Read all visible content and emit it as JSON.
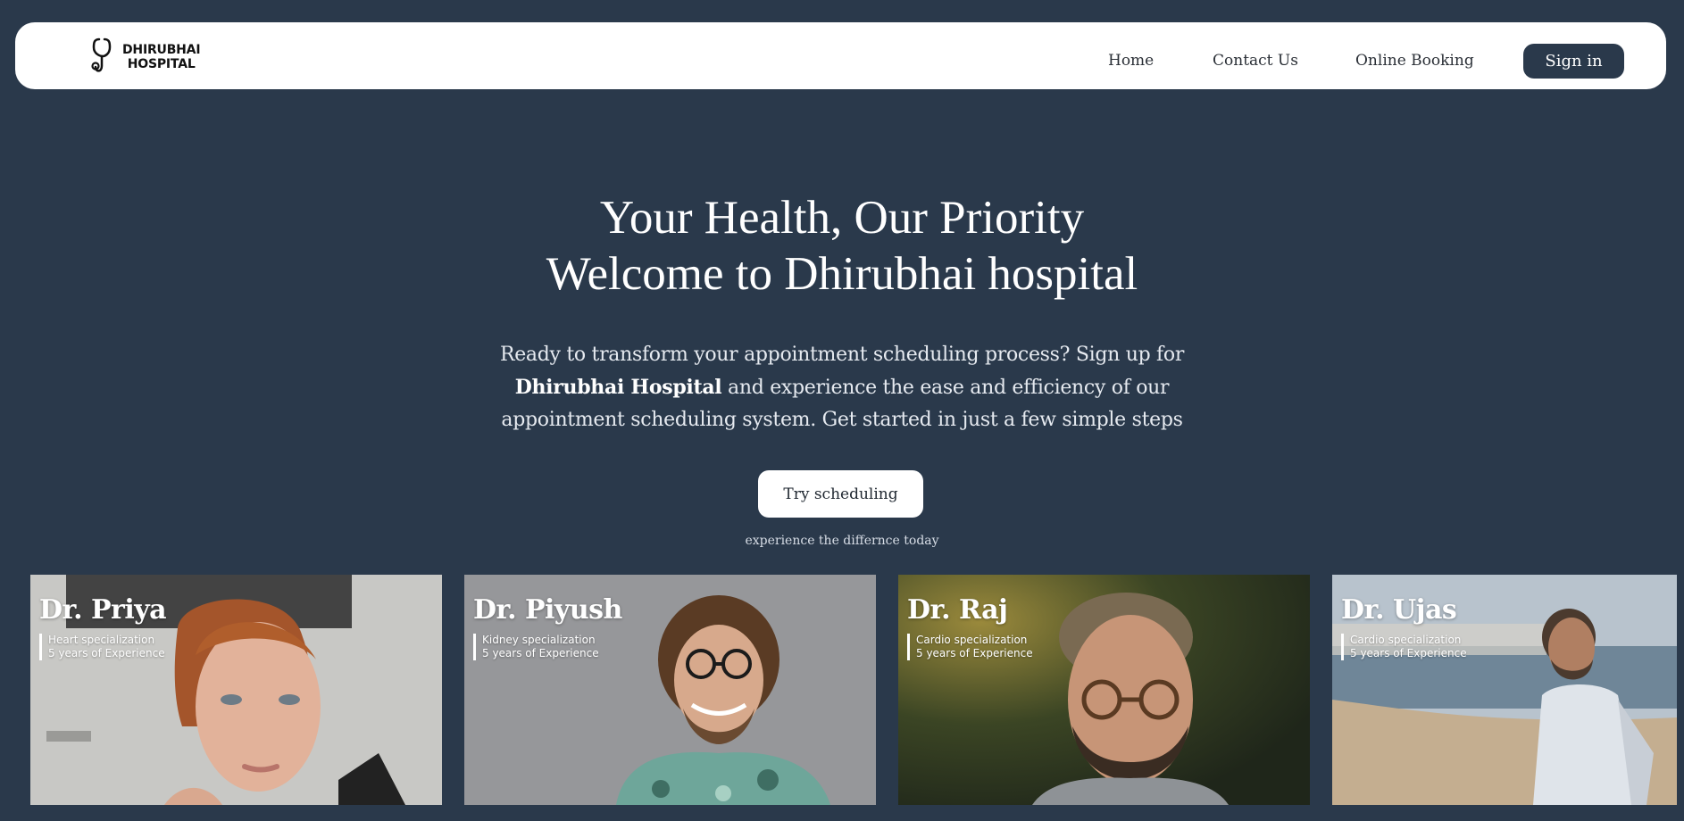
{
  "logo": {
    "line1": "DHIRUBHAI",
    "line2": "HOSPITAL",
    "icon": "stethoscope-icon"
  },
  "nav": {
    "home": "Home",
    "contact": "Contact Us",
    "booking": "Online Booking",
    "signin": "Sign in"
  },
  "hero": {
    "title_line1": "Your Health, Our Priority",
    "title_line2": "Welcome to Dhirubhai hospital",
    "desc_part1": "Ready to transform your appointment scheduling process? Sign up for ",
    "desc_bold": "Dhirubhai Hospital",
    "desc_part2": " and experience the ease and efficiency of our appointment scheduling system. Get started in just a few simple steps",
    "cta": "Try scheduling",
    "caption": "experience the differnce today"
  },
  "doctors": [
    {
      "name": "Dr. Priya",
      "specialization": "Heart specialization",
      "experience": "5 years of Experience"
    },
    {
      "name": "Dr. Piyush",
      "specialization": "Kidney specialization",
      "experience": "5 years of Experience"
    },
    {
      "name": "Dr. Raj",
      "specialization": "Cardio specialization",
      "experience": "5 years of Experience"
    },
    {
      "name": "Dr. Ujas",
      "specialization": "Cardio specialization",
      "experience": "5 years of Experience"
    }
  ],
  "colors": {
    "background": "#2a394b",
    "navbar": "#ffffff",
    "accent": "#2a394b"
  }
}
